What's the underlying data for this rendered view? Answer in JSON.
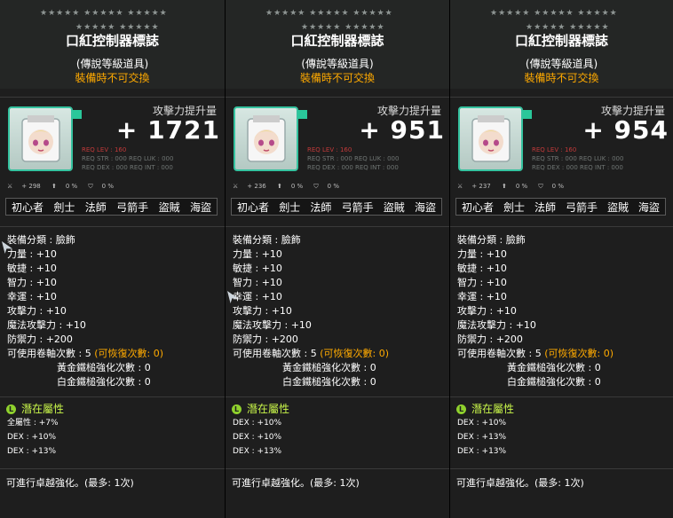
{
  "stars_row1": "★★★★★ ★★★★★ ★★★★★",
  "stars_row2": "★★★★★ ★★★★★",
  "tooltips": [
    {
      "title": "口紅控制器標誌",
      "grade": "(傳說等級道具)",
      "untradable": "裝備時不可交換",
      "atk_label": "攻擊力提升量",
      "atk_value": "+ 1721",
      "req_lev": "REQ LEV : 160",
      "req_stats": "REQ STR : 000  REQ LUK : 000",
      "req_stats2": "REQ DEX : 000  REQ INT : 000",
      "stat_bar": [
        "+ 298",
        "0 %",
        "0 %"
      ],
      "jobs": [
        "初心者",
        "劍士",
        "法師",
        "弓箭手",
        "盜賊",
        "海盜"
      ],
      "stats": [
        "裝備分類 : 臉飾",
        "力量 : +10",
        "敏捷 : +10",
        "智力 : +10",
        "幸運 : +10",
        "攻擊力 : +10",
        "魔法攻擊力 : +10",
        "防禦力 : +200"
      ],
      "upgrade": "可使用卷軸次數 : 5",
      "upgrade_restore": "(可恢復次數: 0)",
      "gold_hammer": "黃金鐵槌強化次數 : 0",
      "platinum_hammer": "白金鐵槌強化次數 : 0",
      "potential_label": "潛在屬性",
      "potential_grade_icon": "L",
      "potentials": [
        "全屬性 : +7%",
        "DEX : +10%",
        "DEX : +13%"
      ],
      "star_note": "可進行卓越強化。(最多: 1次)"
    },
    {
      "title": "口紅控制器標誌",
      "grade": "(傳說等級道具)",
      "untradable": "裝備時不可交換",
      "atk_label": "攻擊力提升量",
      "atk_value": "+ 951",
      "req_lev": "REQ LEV : 160",
      "req_stats": "REQ STR : 000  REQ LUK : 000",
      "req_stats2": "REQ DEX : 000  REQ INT : 000",
      "stat_bar": [
        "+ 236",
        "0 %",
        "0 %"
      ],
      "jobs": [
        "初心者",
        "劍士",
        "法師",
        "弓箭手",
        "盜賊",
        "海盜"
      ],
      "stats": [
        "裝備分類 : 臉飾",
        "力量 : +10",
        "敏捷 : +10",
        "智力 : +10",
        "幸運 : +10",
        "攻擊力 : +10",
        "魔法攻擊力 : +10",
        "防禦力 : +200"
      ],
      "upgrade": "可使用卷軸次數 : 5",
      "upgrade_restore": "(可恢復次數: 0)",
      "gold_hammer": "黃金鐵槌強化次數 : 0",
      "platinum_hammer": "白金鐵槌強化次數 : 0",
      "potential_label": "潛在屬性",
      "potential_grade_icon": "L",
      "potentials": [
        "DEX : +10%",
        "DEX : +10%",
        "DEX : +13%"
      ],
      "star_note": "可進行卓越強化。(最多: 1次)"
    },
    {
      "title": "口紅控制器標誌",
      "grade": "(傳說等級道具)",
      "untradable": "裝備時不可交換",
      "atk_label": "攻擊力提升量",
      "atk_value": "+ 954",
      "req_lev": "REQ LEV : 160",
      "req_stats": "REQ STR : 000  REQ LUK : 000",
      "req_stats2": "REQ DEX : 000  REQ INT : 000",
      "stat_bar": [
        "+ 237",
        "0 %",
        "0 %"
      ],
      "jobs": [
        "初心者",
        "劍士",
        "法師",
        "弓箭手",
        "盜賊",
        "海盜"
      ],
      "stats": [
        "裝備分類 : 臉飾",
        "力量 : +10",
        "敏捷 : +10",
        "智力 : +10",
        "幸運 : +10",
        "攻擊力 : +10",
        "魔法攻擊力 : +10",
        "防禦力 : +200"
      ],
      "upgrade": "可使用卷軸次數 : 5",
      "upgrade_restore": "(可恢復次數: 0)",
      "gold_hammer": "黃金鐵槌強化次數 : 0",
      "platinum_hammer": "白金鐵槌強化次數 : 0",
      "potential_label": "潛在屬性",
      "potential_grade_icon": "L",
      "potentials": [
        "DEX : +10%",
        "DEX : +13%",
        "DEX : +13%"
      ],
      "star_note": "可進行卓越強化。(最多: 1次)"
    }
  ]
}
